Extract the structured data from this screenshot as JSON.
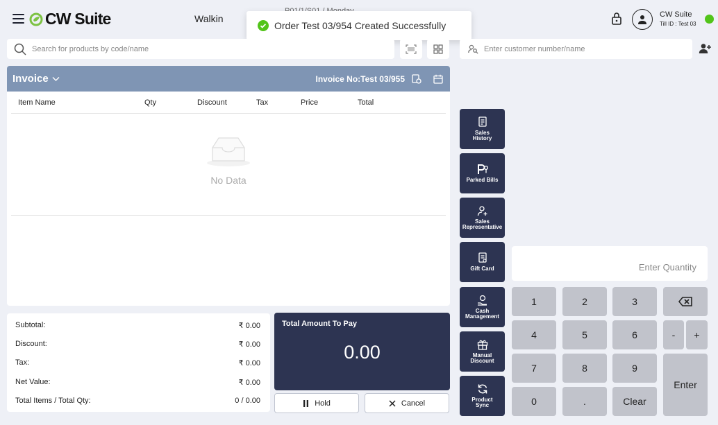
{
  "header": {
    "brand": "CW Suite",
    "customer_type": "Walkin",
    "background_text": "P01/1/S01 / Monday",
    "user_name": "CW Suite",
    "till_id": "Till ID : Test 03",
    "status_color": "#52c41a"
  },
  "toast": {
    "message": "Order Test 03/954 Created Successfully",
    "icon": "check-circle-icon"
  },
  "search": {
    "placeholder": "Search for products by code/name"
  },
  "customer": {
    "placeholder": "Enter customer number/name"
  },
  "invoice": {
    "title": "Invoice",
    "number": "Invoice No:Test 03/955",
    "columns": [
      "Item Name",
      "Qty",
      "Discount",
      "Tax",
      "Price",
      "Total"
    ],
    "empty_text": "No Data",
    "rows": []
  },
  "summary": {
    "rows": [
      {
        "label": "Subtotal:",
        "value": "₹ 0.00"
      },
      {
        "label": "Discount:",
        "value": "₹ 0.00"
      },
      {
        "label": "Tax:",
        "value": "₹ 0.00"
      },
      {
        "label": "Net Value:",
        "value": "₹ 0.00"
      },
      {
        "label": "Total Items / Total Qty:",
        "value": "0 / 0.00"
      }
    ]
  },
  "total": {
    "label": "Total Amount To Pay",
    "value": "0.00"
  },
  "actions": {
    "hold": "Hold",
    "cancel": "Cancel"
  },
  "side_buttons": [
    {
      "line1": "Sales",
      "line2": "History",
      "icon": "receipt-icon"
    },
    {
      "line1": "Parked Bills",
      "line2": "",
      "icon": "parking-icon"
    },
    {
      "line1": "Sales",
      "line2": "Representative",
      "icon": "user-add-icon"
    },
    {
      "line1": "Gift Card",
      "line2": "",
      "icon": "gift-card-icon"
    },
    {
      "line1": "Cash",
      "line2": "Management",
      "icon": "cash-icon"
    },
    {
      "line1": "Manual",
      "line2": "Discount",
      "icon": "gift-icon"
    },
    {
      "line1": "Product",
      "line2": "Sync",
      "icon": "sync-icon"
    }
  ],
  "keypad": {
    "placeholder": "Enter Quantity",
    "keys": [
      "1",
      "2",
      "3",
      "4",
      "5",
      "6",
      "7",
      "8",
      "9",
      "0",
      "."
    ],
    "minus": "-",
    "plus": "+",
    "clear": "Clear",
    "enter": "Enter"
  },
  "colors": {
    "accent": "#2d3452",
    "invoice_header": "#7f95b4",
    "key": "#c1c3cb",
    "brand_green": "#7cc242"
  }
}
